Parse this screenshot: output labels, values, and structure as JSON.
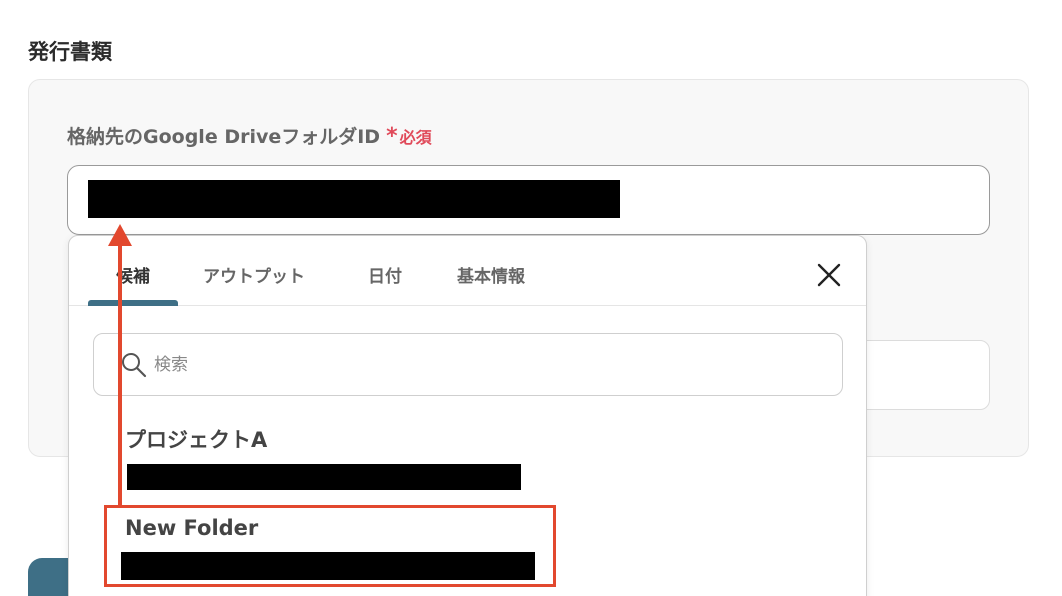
{
  "section": {
    "title": "発行書類"
  },
  "field": {
    "label": "格納先のGoogle DriveフォルダID",
    "required_star": "*",
    "required_text": "必須"
  },
  "dropdown": {
    "tabs": [
      {
        "label": "候補",
        "active": true
      },
      {
        "label": "アウトプット",
        "active": false
      },
      {
        "label": "日付",
        "active": false
      },
      {
        "label": "基本情報",
        "active": false
      }
    ],
    "search": {
      "placeholder": "検索",
      "icon": "search-icon"
    },
    "items": [
      {
        "title": "プロジェクトA"
      },
      {
        "title": "New Folder"
      }
    ]
  },
  "colors": {
    "accent": "#3e6f86",
    "required": "#e04a5a",
    "annotation": "#e2482e"
  }
}
